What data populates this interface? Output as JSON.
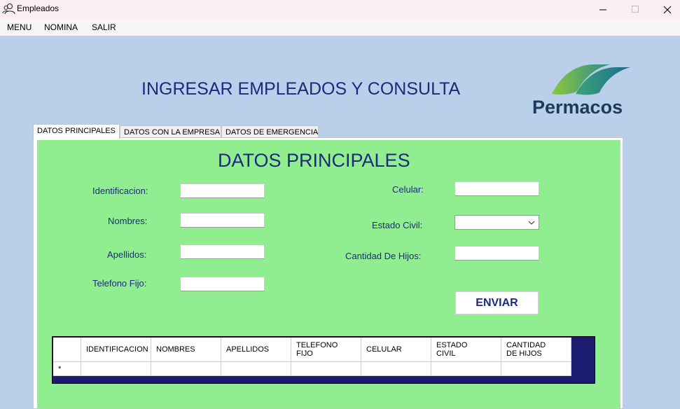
{
  "window": {
    "title": "Empleados"
  },
  "menu": {
    "items": [
      "MENU",
      "NOMINA",
      "SALIR"
    ]
  },
  "header": {
    "title": "INGRESAR EMPLEADOS Y CONSULTA",
    "logo_text": "Permacos"
  },
  "tabs": [
    {
      "label": "DATOS PRINCIPALES",
      "active": true
    },
    {
      "label": "DATOS CON LA EMPRESA",
      "active": false
    },
    {
      "label": "DATOS DE EMERGENCIA",
      "active": false
    }
  ],
  "form": {
    "section_title": "DATOS PRINCIPALES",
    "identificacion": {
      "label": "Identificacion:",
      "value": ""
    },
    "nombres": {
      "label": "Nombres:",
      "value": ""
    },
    "apellidos": {
      "label": "Apellidos:",
      "value": ""
    },
    "telefono_fijo": {
      "label": "Telefono Fijo:",
      "value": ""
    },
    "celular": {
      "label": "Celular:",
      "value": ""
    },
    "estado_civil": {
      "label": "Estado Civil:",
      "value": ""
    },
    "cantidad_hijos": {
      "label": "Cantidad De Hijos:",
      "value": ""
    },
    "submit_label": "ENVIAR"
  },
  "grid": {
    "columns": [
      "IDENTIFICACION",
      "NOMBRES",
      "APELLIDOS",
      "TELEFONO\nFIJO",
      "CELULAR",
      "ESTADO\nCIVIL",
      "CANTIDAD\nDE HIJOS"
    ],
    "new_row_marker": "*"
  },
  "colors": {
    "background": "#b9cfea",
    "panel": "#90ee90",
    "title_text": "#1c2a7c",
    "grid_border": "#1b1c70"
  }
}
